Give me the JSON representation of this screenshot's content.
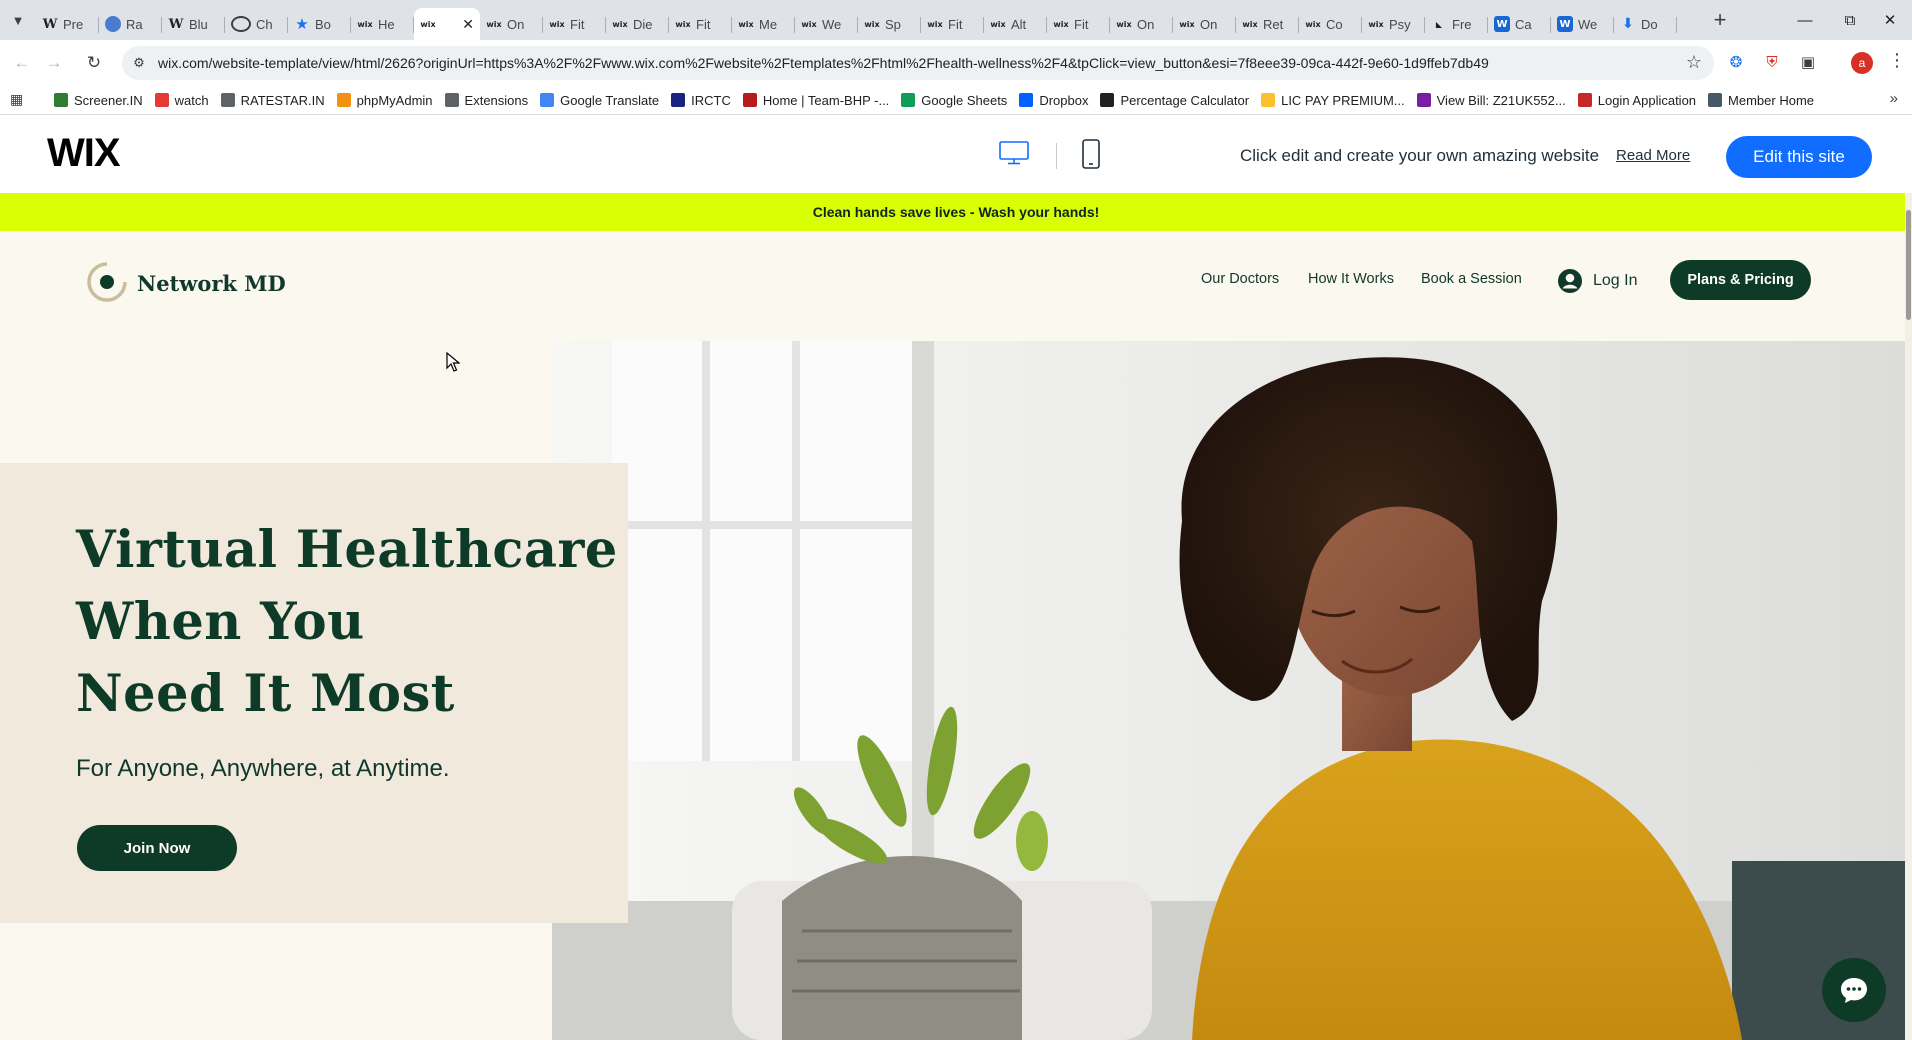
{
  "browser": {
    "tabs": [
      {
        "icon": "wikipedia-icon",
        "label": "Pre"
      },
      {
        "icon": "globe-icon",
        "label": "Ra"
      },
      {
        "icon": "wikipedia-icon",
        "label": "Blu"
      },
      {
        "icon": "chatgpt-icon",
        "label": "Ch"
      },
      {
        "icon": "star-icon",
        "label": "Bo"
      },
      {
        "icon": "wix-icon",
        "label": "He"
      },
      {
        "icon": "wix-icon",
        "label": "",
        "active": true
      },
      {
        "icon": "wix-icon",
        "label": "On"
      },
      {
        "icon": "wix-icon",
        "label": "Fit"
      },
      {
        "icon": "wix-icon",
        "label": "Die"
      },
      {
        "icon": "wix-icon",
        "label": "Fit"
      },
      {
        "icon": "wix-icon",
        "label": "Me"
      },
      {
        "icon": "wix-icon",
        "label": "We"
      },
      {
        "icon": "wix-icon",
        "label": "Sp"
      },
      {
        "icon": "wix-icon",
        "label": "Fit"
      },
      {
        "icon": "wix-icon",
        "label": "Alt"
      },
      {
        "icon": "wix-icon",
        "label": "Fit"
      },
      {
        "icon": "wix-icon",
        "label": "On"
      },
      {
        "icon": "wix-icon",
        "label": "On"
      },
      {
        "icon": "wix-icon",
        "label": "Ret"
      },
      {
        "icon": "wix-icon",
        "label": "Co"
      },
      {
        "icon": "wix-icon",
        "label": "Psy"
      },
      {
        "icon": "tf-icon",
        "label": "Fre"
      },
      {
        "icon": "blue-w-icon",
        "label": "Ca"
      },
      {
        "icon": "blue-w-icon",
        "label": "We"
      },
      {
        "icon": "download-icon",
        "label": "Do"
      }
    ],
    "url": "wix.com/website-template/view/html/2626?originUrl=https%3A%2F%2Fwww.wix.com%2Fwebsite%2Ftemplates%2Fhtml%2Fhealth-wellness%2F4&tpClick=view_button&esi=7f8eee39-09ca-442f-9e60-1d9ffeb7db49",
    "profile_initial": "a",
    "bookmarks": [
      {
        "label": "Screener.IN",
        "color": "#2e7d32"
      },
      {
        "label": "watch",
        "color": "#e53935"
      },
      {
        "label": "RATESTAR.IN",
        "color": "#5f6368"
      },
      {
        "label": "phpMyAdmin",
        "color": "#f29111"
      },
      {
        "label": "Extensions",
        "color": "#5f6368"
      },
      {
        "label": "Google Translate",
        "color": "#4285f4"
      },
      {
        "label": "IRCTC",
        "color": "#1a237e"
      },
      {
        "label": "Home | Team-BHP -...",
        "color": "#b71c1c"
      },
      {
        "label": "Google Sheets",
        "color": "#0f9d58"
      },
      {
        "label": "Dropbox",
        "color": "#0061fe"
      },
      {
        "label": "Percentage Calculator",
        "color": "#222222"
      },
      {
        "label": "LIC PAY PREMIUM...",
        "color": "#fbc02d"
      },
      {
        "label": "View Bill: Z21UK552...",
        "color": "#7b1fa2"
      },
      {
        "label": "Login Application",
        "color": "#c62828"
      },
      {
        "label": "Member Home",
        "color": "#455a64"
      }
    ]
  },
  "wix_bar": {
    "logo": "WIX",
    "promo": "Click edit and create your own amazing website",
    "read_more": "Read More",
    "edit_button": "Edit this site"
  },
  "site": {
    "announcement": "Clean hands save lives - Wash your hands!",
    "brand": "Network MD",
    "nav": [
      "Our Doctors",
      "How It Works",
      "Book a Session"
    ],
    "login": "Log In",
    "plans_button": "Plans & Pricing",
    "hero": {
      "title_lines": [
        "Virtual Healthcare",
        "When You",
        "Need It Most"
      ],
      "subtitle": "For Anyone, Anywhere, at Anytime.",
      "cta": "Join Now"
    }
  },
  "colors": {
    "banner": "#d8ff04",
    "brand_green": "#0e3a28",
    "wix_blue": "#116dff",
    "page_bg": "#fbf8ef",
    "card_bg": "#f0e9dc"
  }
}
